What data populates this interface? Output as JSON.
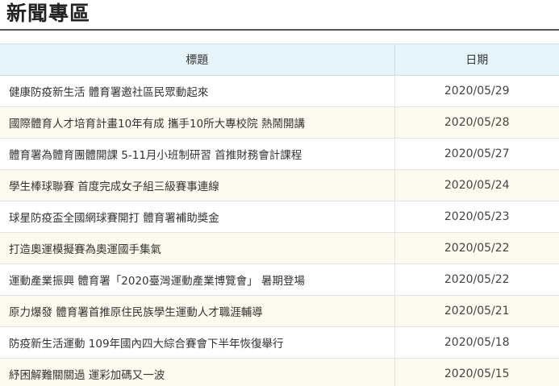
{
  "page": {
    "title": "新聞專區"
  },
  "table": {
    "headers": {
      "title": "標題",
      "date": "日期"
    },
    "rows": [
      {
        "title": "健康防疫新生活 體育署邀社區民眾動起來",
        "date": "2020/05/29"
      },
      {
        "title": "國際體育人才培育計畫10年有成 攜手10所大專校院 熱鬧開講",
        "date": "2020/05/28"
      },
      {
        "title": "體育署為體育團體開課 5-11月小班制研習 首推財務會計課程",
        "date": "2020/05/27"
      },
      {
        "title": "學生棒球聯賽 首度完成女子組三級賽事連線",
        "date": "2020/05/24"
      },
      {
        "title": "球星防疫盃全國網球賽開打 體育署補助獎金",
        "date": "2020/05/23"
      },
      {
        "title": "打造奧運模擬賽為奧運國手集氣",
        "date": "2020/05/22"
      },
      {
        "title": "運動產業振興 體育署「2020臺灣運動產業博覽會」 暑期登場",
        "date": "2020/05/22"
      },
      {
        "title": "原力爆發 體育署首推原住民族學生運動人才職涯輔導",
        "date": "2020/05/21"
      },
      {
        "title": "防疫新生活運動 109年國內四大綜合賽會下半年恢復舉行",
        "date": "2020/05/18"
      },
      {
        "title": "紓困解難關關過 運彩加碼又一波",
        "date": "2020/05/15"
      }
    ]
  }
}
